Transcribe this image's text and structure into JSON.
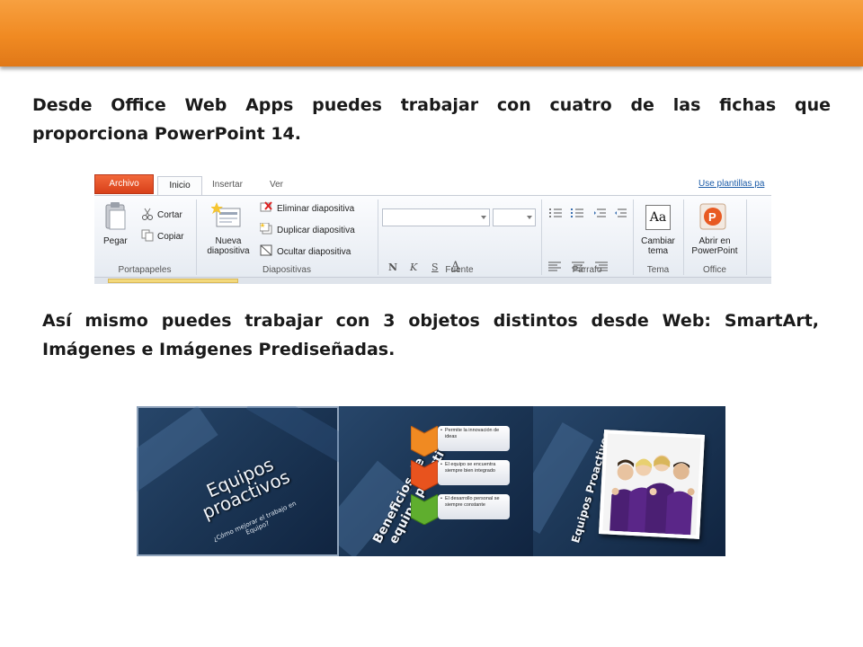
{
  "paragraph1": {
    "lines": [
      "Desde Office Web Apps puedes trabajar con cuatro de las fichas que",
      "proporciona PowerPoint 14."
    ]
  },
  "paragraph2": {
    "lines": [
      "Así mismo puedes trabajar con 3 objetos distintos desde Web: SmartArt,",
      "Imágenes e Imágenes Prediseñadas."
    ]
  },
  "ribbon": {
    "tabs": {
      "archivo": "Archivo",
      "inicio": "Inicio",
      "insertar": "Insertar",
      "ver": "Ver"
    },
    "template_link": "Use plantillas pa",
    "groups": {
      "portapapeles": {
        "label": "Portapapeles",
        "pegar": "Pegar",
        "cortar": "Cortar",
        "copiar": "Copiar"
      },
      "diapositivas": {
        "label": "Diapositivas",
        "nueva_line1": "Nueva",
        "nueva_line2": "diapositiva",
        "eliminar": "Eliminar diapositiva",
        "duplicar": "Duplicar diapositiva",
        "ocultar": "Ocultar diapositiva"
      },
      "fuente": {
        "label": "Fuente",
        "bold": "N",
        "italic": "K",
        "shadow": "S",
        "color": "A"
      },
      "parrafo": {
        "label": "Párrafo"
      },
      "tema": {
        "label": "Tema",
        "cambiar_line1": "Cambiar",
        "cambiar_line2": "tema",
        "icon_text": "Aa"
      },
      "office": {
        "label": "Office",
        "abrir_line1": "Abrir en",
        "abrir_line2": "PowerPoint"
      }
    },
    "colors": {
      "archivo_tab": "#d8401a",
      "ribbon_bg": "#e6ebf2",
      "link": "#1c5ca8"
    }
  },
  "slides": {
    "slide1": {
      "title_line1": "Equipos",
      "title_line2": "proactivos",
      "sub_line1": "¿Cómo mejorar el trabajo en",
      "sub_line2": "Equipo?"
    },
    "slide2": {
      "title_line1": "Beneficios de un",
      "title_line2": "equipo proactivo",
      "bullets": [
        "Permite la innovación de ideas",
        "El equipo se encuentra siempre bien integrado",
        "El desarrollo personal se siempre constante"
      ],
      "chevron_colors": [
        "#f08a22",
        "#e8531e",
        "#5fae2e"
      ]
    },
    "slide3": {
      "title": "Equipos Proactivos"
    }
  },
  "header_band_color": "#f08a22"
}
